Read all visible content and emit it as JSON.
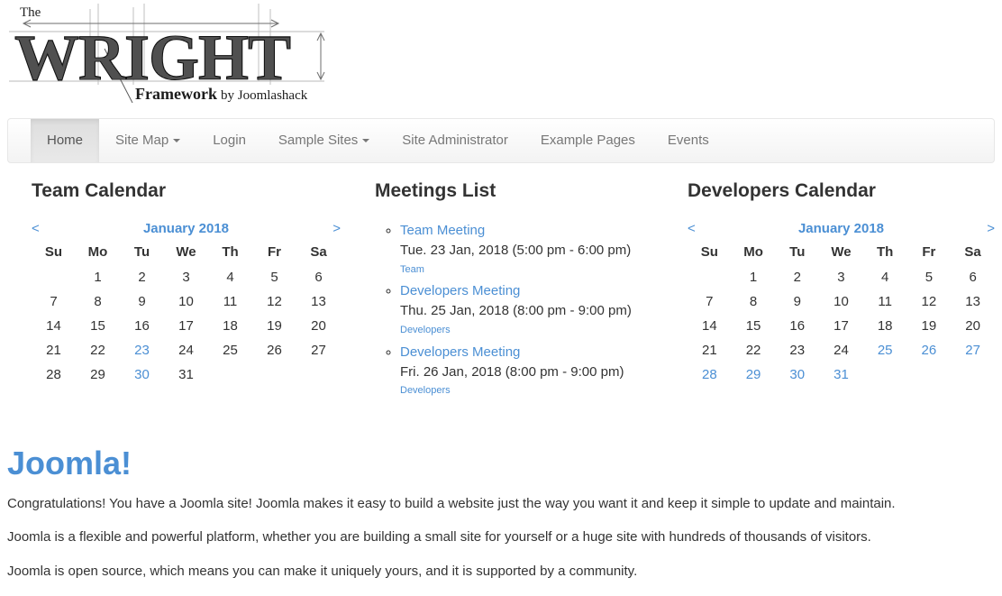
{
  "site": {
    "logo": {
      "the": "The",
      "wordmark": "WRIGHT",
      "tagline_main": "Framework",
      "tagline_by": "by Joomlashack"
    }
  },
  "nav": {
    "items": [
      {
        "label": "Home",
        "active": true,
        "caret": false
      },
      {
        "label": "Site Map",
        "active": false,
        "caret": true
      },
      {
        "label": "Login",
        "active": false,
        "caret": false
      },
      {
        "label": "Sample Sites",
        "active": false,
        "caret": true
      },
      {
        "label": "Site Administrator",
        "active": false,
        "caret": false
      },
      {
        "label": "Example Pages",
        "active": false,
        "caret": false
      },
      {
        "label": "Events",
        "active": false,
        "caret": false
      }
    ]
  },
  "team_calendar": {
    "title": "Team Calendar",
    "prev": "<",
    "next": ">",
    "month": "January 2018",
    "weekdays": [
      "Su",
      "Mo",
      "Tu",
      "We",
      "Th",
      "Fr",
      "Sa"
    ],
    "weeks": [
      [
        "",
        "1",
        "2",
        "3",
        "4",
        "5",
        "6"
      ],
      [
        "7",
        "8",
        "9",
        "10",
        "11",
        "12",
        "13"
      ],
      [
        "14",
        "15",
        "16",
        "17",
        "18",
        "19",
        "20"
      ],
      [
        "21",
        "22",
        "23",
        "24",
        "25",
        "26",
        "27"
      ],
      [
        "28",
        "29",
        "30",
        "31",
        "",
        "",
        ""
      ]
    ],
    "linked_days": [
      "23",
      "30"
    ]
  },
  "meetings": {
    "title": "Meetings List",
    "items": [
      {
        "name": "Team Meeting",
        "when": "Tue. 23 Jan, 2018 (5:00 pm - 6:00 pm)",
        "category": "Team"
      },
      {
        "name": "Developers Meeting",
        "when": "Thu. 25 Jan, 2018 (8:00 pm - 9:00 pm)",
        "category": "Developers"
      },
      {
        "name": "Developers Meeting",
        "when": "Fri. 26 Jan, 2018 (8:00 pm - 9:00 pm)",
        "category": "Developers"
      }
    ]
  },
  "dev_calendar": {
    "title": "Developers Calendar",
    "prev": "<",
    "next": ">",
    "month": "January 2018",
    "weekdays": [
      "Su",
      "Mo",
      "Tu",
      "We",
      "Th",
      "Fr",
      "Sa"
    ],
    "weeks": [
      [
        "",
        "1",
        "2",
        "3",
        "4",
        "5",
        "6"
      ],
      [
        "7",
        "8",
        "9",
        "10",
        "11",
        "12",
        "13"
      ],
      [
        "14",
        "15",
        "16",
        "17",
        "18",
        "19",
        "20"
      ],
      [
        "21",
        "22",
        "23",
        "24",
        "25",
        "26",
        "27"
      ],
      [
        "28",
        "29",
        "30",
        "31",
        "",
        "",
        ""
      ]
    ],
    "linked_days": [
      "25",
      "26",
      "27",
      "28",
      "29",
      "30",
      "31"
    ]
  },
  "article": {
    "heading": "Joomla!",
    "paragraphs": [
      "Congratulations! You have a Joomla site! Joomla makes it easy to build a website just the way you want it and keep it simple to update and maintain.",
      "Joomla is a flexible and powerful platform, whether you are building a small site for yourself or a huge site with hundreds of thousands of visitors.",
      "Joomla is open source, which means you can make it uniquely yours, and it is supported by a community."
    ]
  },
  "colors": {
    "link_blue": "#4b8fd4",
    "text_dark": "#333333",
    "nav_text": "#777777",
    "navbar_bg": "#f8f8f8",
    "navbar_active_bg": "#e7e7e7"
  }
}
